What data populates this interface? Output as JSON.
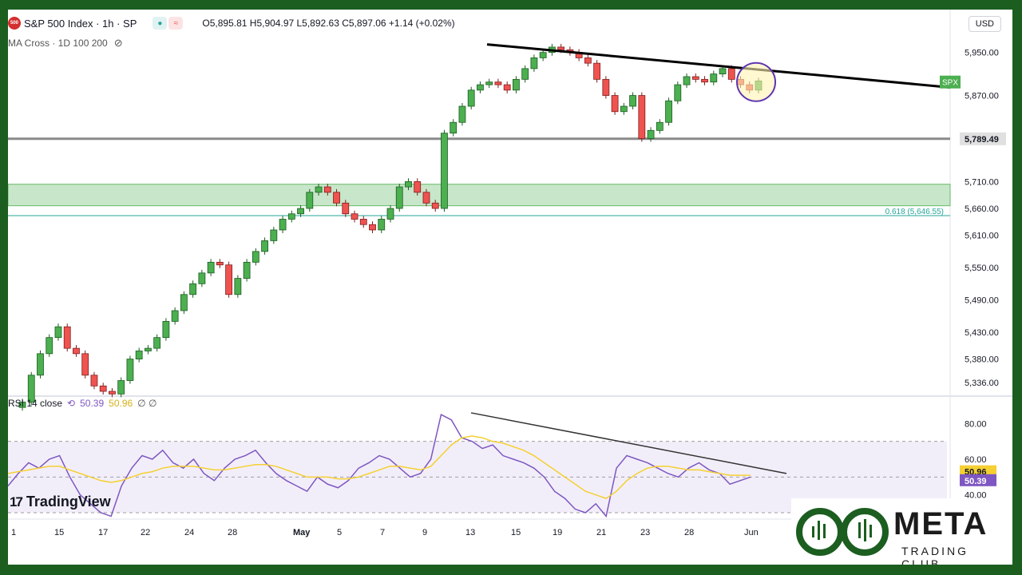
{
  "header": {
    "symbol_badge": "500",
    "title": "S&P 500 Index · 1h · SP",
    "ohlc": "O5,895.81 H5,904.97 L5,892.63 C5,897.06 +1.14 (+0.02%)",
    "currency": "USD",
    "indicator": "MA Cross · 1D 100 200"
  },
  "rsi_legend": {
    "label": "RSI 14 close",
    "rsi": "50.39",
    "ma": "50.96",
    "extra": "∅ ∅"
  },
  "branding": {
    "tradingview": "TradingView",
    "meta": "META",
    "club": "TRADING CLUB"
  },
  "colors": {
    "up": "#26a69a",
    "up_fill": "#4caf50",
    "down": "#ef5350",
    "rsi_line": "#7e57c2",
    "rsi_ma": "#f5d033",
    "zone": "#c8e6c9",
    "brand_green": "#1b5e20"
  },
  "chart_data": [
    {
      "type": "candlestick",
      "title": "S&P 500 Index · 1h · SP",
      "y_ticks": [
        "5,950.00",
        "5,870.00",
        "5,789.49",
        "5,710.00",
        "5,660.00",
        "5,610.00",
        "5,550.00",
        "5,490.00",
        "5,430.00",
        "5,380.00",
        "5,336.00"
      ],
      "x_ticks": [
        "1",
        "15",
        "17",
        "22",
        "24",
        "28",
        "May",
        "5",
        "7",
        "9",
        "13",
        "15",
        "19",
        "21",
        "23",
        "28",
        "Jun"
      ],
      "horizontal_level": {
        "value": 5789.49,
        "label": "5,789.49"
      },
      "fib_level": {
        "label": "0.618 (5,646.55)",
        "value": 5646.55
      },
      "zone": {
        "low": 5665,
        "high": 5705
      },
      "price_tag": {
        "label": "SPX"
      },
      "trendline": {
        "from": {
          "x": "15",
          "y": 5965
        },
        "to": {
          "x": "Jun+",
          "y": 5885
        }
      },
      "series_close": [
        5300,
        5350,
        5390,
        5420,
        5440,
        5400,
        5390,
        5350,
        5330,
        5320,
        5315,
        5340,
        5380,
        5395,
        5400,
        5420,
        5450,
        5470,
        5500,
        5520,
        5540,
        5560,
        5555,
        5500,
        5530,
        5560,
        5580,
        5600,
        5620,
        5640,
        5650,
        5660,
        5690,
        5700,
        5690,
        5670,
        5650,
        5640,
        5630,
        5620,
        5640,
        5660,
        5700,
        5710,
        5690,
        5670,
        5660,
        5800,
        5820,
        5850,
        5880,
        5890,
        5895,
        5890,
        5880,
        5900,
        5920,
        5940,
        5950,
        5960,
        5955,
        5950,
        5940,
        5930,
        5900,
        5870,
        5840,
        5850,
        5870,
        5790,
        5805,
        5820,
        5860,
        5890,
        5905,
        5900,
        5895,
        5910,
        5920,
        5900,
        5890,
        5880,
        5897
      ]
    },
    {
      "type": "line",
      "title": "RSI 14 close",
      "y_ticks": [
        "80.00",
        "60.00",
        "40.00"
      ],
      "badges": [
        "50.96",
        "50.39"
      ],
      "rsi_series": [
        45,
        52,
        58,
        55,
        60,
        62,
        50,
        40,
        35,
        30,
        28,
        45,
        55,
        62,
        60,
        65,
        58,
        55,
        60,
        52,
        48,
        55,
        60,
        62,
        65,
        58,
        52,
        48,
        45,
        42,
        50,
        46,
        44,
        48,
        55,
        58,
        62,
        60,
        55,
        50,
        52,
        60,
        85,
        82,
        72,
        70,
        66,
        68,
        62,
        60,
        58,
        55,
        50,
        42,
        38,
        32,
        30,
        35,
        28,
        55,
        62,
        60,
        58,
        55,
        52,
        50,
        55,
        58,
        54,
        52,
        46,
        48,
        50
      ],
      "rsi_ma_series": [
        52,
        53,
        54,
        55,
        56,
        56,
        54,
        52,
        50,
        48,
        47,
        48,
        50,
        52,
        53,
        55,
        56,
        56,
        56,
        55,
        54,
        54,
        55,
        56,
        57,
        57,
        56,
        54,
        52,
        50,
        50,
        50,
        49,
        49,
        50,
        52,
        54,
        56,
        56,
        55,
        54,
        56,
        62,
        68,
        72,
        73,
        72,
        70,
        69,
        67,
        65,
        62,
        58,
        54,
        50,
        46,
        42,
        40,
        38,
        42,
        48,
        52,
        55,
        56,
        56,
        55,
        54,
        54,
        53,
        52,
        51,
        51,
        51
      ],
      "trendline": {
        "from": 86,
        "to": 52
      }
    }
  ]
}
